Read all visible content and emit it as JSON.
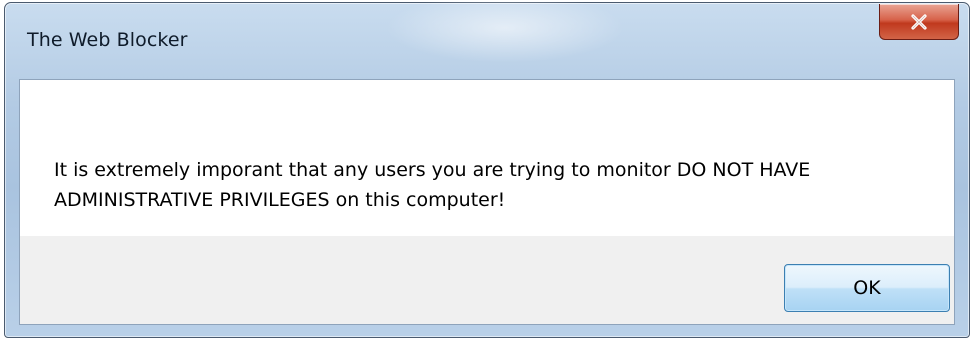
{
  "window": {
    "title": "The Web Blocker"
  },
  "dialog": {
    "message": "It is extremely imporant that any users you are trying to monitor DO NOT HAVE ADMINISTRATIVE PRIVILEGES on this computer!",
    "ok_label": "OK"
  },
  "icons": {
    "close": "close-icon"
  },
  "colors": {
    "titlebar": "#b3cbe4",
    "close_button": "#c0391e",
    "ok_button_border": "#3c7fb1",
    "button_area": "#f0f0f0",
    "content_area": "#ffffff"
  }
}
